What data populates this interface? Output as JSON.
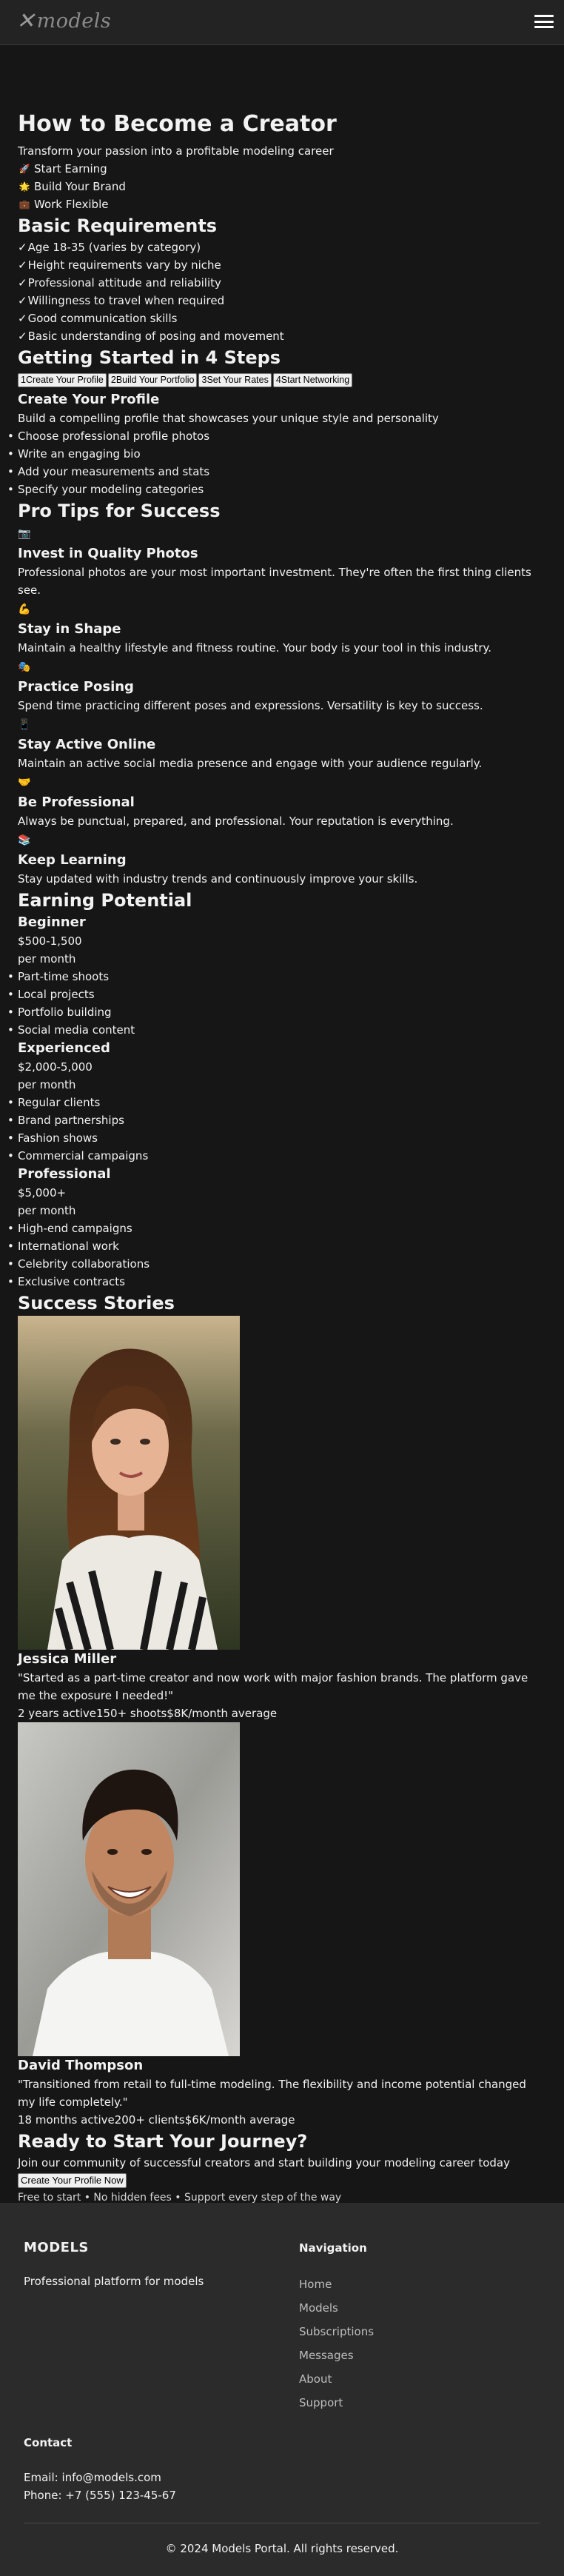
{
  "header": {
    "logo": "models",
    "menu_icon": "hamburger-menu-icon"
  },
  "hero": {
    "title": "How to Become a Creator",
    "subtitle": "Transform your passion into a profitable modeling career",
    "items": [
      {
        "icon": "rocket-icon",
        "glyph": "🚀",
        "label": "Start Earning"
      },
      {
        "icon": "star-icon",
        "glyph": "🌟",
        "label": "Build Your Brand"
      },
      {
        "icon": "briefcase-icon",
        "glyph": "💼",
        "label": "Work Flexible"
      }
    ]
  },
  "requirements": {
    "title": "Basic Requirements",
    "check": "✓",
    "items": [
      "Age 18-35 (varies by category)",
      "Height requirements vary by niche",
      "Professional attitude and reliability",
      "Willingness to travel when required",
      "Good communication skills",
      "Basic understanding of posing and movement"
    ]
  },
  "steps": {
    "title": "Getting Started in 4 Steps",
    "tabs": [
      {
        "num": "1",
        "label": "Create Your Profile"
      },
      {
        "num": "2",
        "label": "Build Your Portfolio"
      },
      {
        "num": "3",
        "label": "Set Your Rates"
      },
      {
        "num": "4",
        "label": "Start Networking"
      }
    ],
    "active": {
      "title": "Create Your Profile",
      "description": "Build a compelling profile that showcases your unique style and personality",
      "items": [
        "Choose professional profile photos",
        "Write an engaging bio",
        "Add your measurements and stats",
        "Specify your modeling categories"
      ]
    }
  },
  "tips": {
    "title": "Pro Tips for Success",
    "items": [
      {
        "icon": "camera-icon",
        "glyph": "📷",
        "title": "Invest in Quality Photos",
        "text": "Professional photos are your most important investment. They're often the first thing clients see."
      },
      {
        "icon": "muscle-icon",
        "glyph": "💪",
        "title": "Stay in Shape",
        "text": "Maintain a healthy lifestyle and fitness routine. Your body is your tool in this industry."
      },
      {
        "icon": "theater-masks-icon",
        "glyph": "🎭",
        "title": "Practice Posing",
        "text": "Spend time practicing different poses and expressions. Versatility is key to success."
      },
      {
        "icon": "phone-icon",
        "glyph": "📱",
        "title": "Stay Active Online",
        "text": "Maintain an active social media presence and engage with your audience regularly."
      },
      {
        "icon": "handshake-icon",
        "glyph": "🤝",
        "title": "Be Professional",
        "text": "Always be punctual, prepared, and professional. Your reputation is everything."
      },
      {
        "icon": "books-icon",
        "glyph": "📚",
        "title": "Keep Learning",
        "text": "Stay updated with industry trends and continuously improve your skills."
      }
    ]
  },
  "earnings": {
    "title": "Earning Potential",
    "tiers": [
      {
        "name": "Beginner",
        "price": "$500-1,500",
        "period": "per month",
        "items": [
          "Part-time shoots",
          "Local projects",
          "Portfolio building",
          "Social media content"
        ]
      },
      {
        "name": "Experienced",
        "price": "$2,000-5,000",
        "period": "per month",
        "items": [
          "Regular clients",
          "Brand partnerships",
          "Fashion shows",
          "Commercial campaigns"
        ]
      },
      {
        "name": "Professional",
        "price": "$5,000+",
        "period": "per month",
        "items": [
          "High-end campaigns",
          "International work",
          "Celebrity collaborations",
          "Exclusive contracts"
        ]
      }
    ]
  },
  "stories": {
    "title": "Success Stories",
    "items": [
      {
        "name": "Jessica Miller",
        "quote": "\"Started as a part-time creator and now work with major fashion brands. The platform gave me the exposure I needed!\"",
        "stats": [
          "2 years active",
          "150+ shoots",
          "$8K/month average"
        ]
      },
      {
        "name": "David Thompson",
        "quote": "\"Transitioned from retail to full-time modeling. The flexibility and income potential changed my life completely.\"",
        "stats": [
          "18 months active",
          "200+ clients",
          "$6K/month average"
        ]
      }
    ]
  },
  "cta": {
    "title": "Ready to Start Your Journey?",
    "text": "Join our community of successful creators and start building your modeling career today",
    "button": "Create Your Profile Now",
    "note": "Free to start • No hidden fees • Support every step of the way"
  },
  "footer": {
    "brand": "MODELS",
    "description": "Professional platform for models",
    "nav_title": "Navigation",
    "nav": [
      "Home",
      "Models",
      "Subscriptions",
      "Messages",
      "About",
      "Support"
    ],
    "contact_title": "Contact",
    "email": "Email: info@models.com",
    "phone": "Phone: +7 (555) 123-45-67",
    "copyright": "© 2024 Models Portal. All rights reserved."
  }
}
